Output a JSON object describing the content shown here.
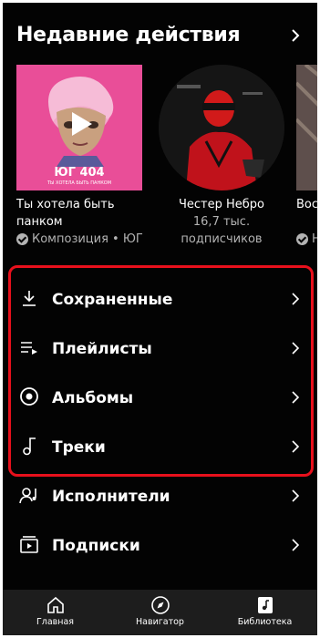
{
  "header": {
    "title": "Недавние действия"
  },
  "recent": [
    {
      "title_line1": "Ты хотела быть",
      "title_line2": "панком",
      "meta": "Композиция • ЮГ",
      "art_text_big": "ЮГ 404",
      "art_text_small": "ТЫ ХОТЕЛА БЫТЬ ПАНКОМ"
    },
    {
      "title_line1": "Честер Небро",
      "meta_line1": "16,7 тыс.",
      "meta_line2": "подписчиков"
    },
    {
      "title_line1": "Вос",
      "meta": "Н"
    }
  ],
  "library": [
    {
      "label": "Сохраненные",
      "icon": "download-icon"
    },
    {
      "label": "Плейлисты",
      "icon": "playlist-icon"
    },
    {
      "label": "Альбомы",
      "icon": "album-icon"
    },
    {
      "label": "Треки",
      "icon": "music-note-icon"
    },
    {
      "label": "Исполнители",
      "icon": "artist-icon"
    },
    {
      "label": "Подписки",
      "icon": "subscriptions-icon"
    }
  ],
  "bottom_nav": [
    {
      "label": "Главная",
      "icon": "home-icon"
    },
    {
      "label": "Навигатор",
      "icon": "compass-icon"
    },
    {
      "label": "Библиотека",
      "icon": "library-icon"
    }
  ],
  "colors": {
    "background": "#030303",
    "highlight_border": "#e8101c",
    "nav_background": "#1d1d1d",
    "secondary_text": "#b3b3b3"
  }
}
